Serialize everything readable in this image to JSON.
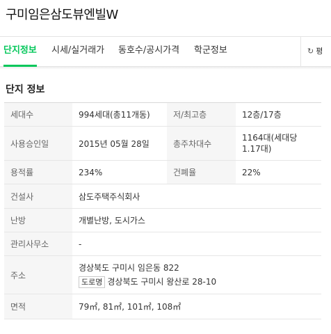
{
  "page": {
    "title": "구미임은삼도뷰엔빌W"
  },
  "tabs": [
    {
      "label": "단지정보",
      "active": true
    },
    {
      "label": "시세/실거래가",
      "active": false
    },
    {
      "label": "동호수/공시가격",
      "active": false
    },
    {
      "label": "학군정보",
      "active": false
    }
  ],
  "refresh": {
    "icon": "refresh-icon",
    "label": "평"
  },
  "section": {
    "title": "단지 정보"
  },
  "info": {
    "households_label": "세대수",
    "households_value": "994세대(총11개동)",
    "floors_label": "저/최고층",
    "floors_value": "12층/17층",
    "approval_label": "사용승인일",
    "approval_value": "2015년 05월 28일",
    "parking_label": "총주차대수",
    "parking_value": "1164대(세대당 1.17대)",
    "far_label": "용적률",
    "far_value": "234%",
    "bcr_label": "건폐율",
    "bcr_value": "22%",
    "builder_label": "건설사",
    "builder_value": "삼도주택주식회사",
    "heating_label": "난방",
    "heating_value": "개별난방, 도시가스",
    "office_label": "관리사무소",
    "office_value": "-",
    "address_label": "주소",
    "address_lot": "경상북도 구미시 임은동 822",
    "address_road_badge": "도로명",
    "address_road": "경상북도 구미시 왕산로 28-10",
    "area_label": "면적",
    "area_value": "79㎡, 81㎡, 101㎡, 108㎡"
  },
  "colors": {
    "accent": "#03c75a"
  }
}
